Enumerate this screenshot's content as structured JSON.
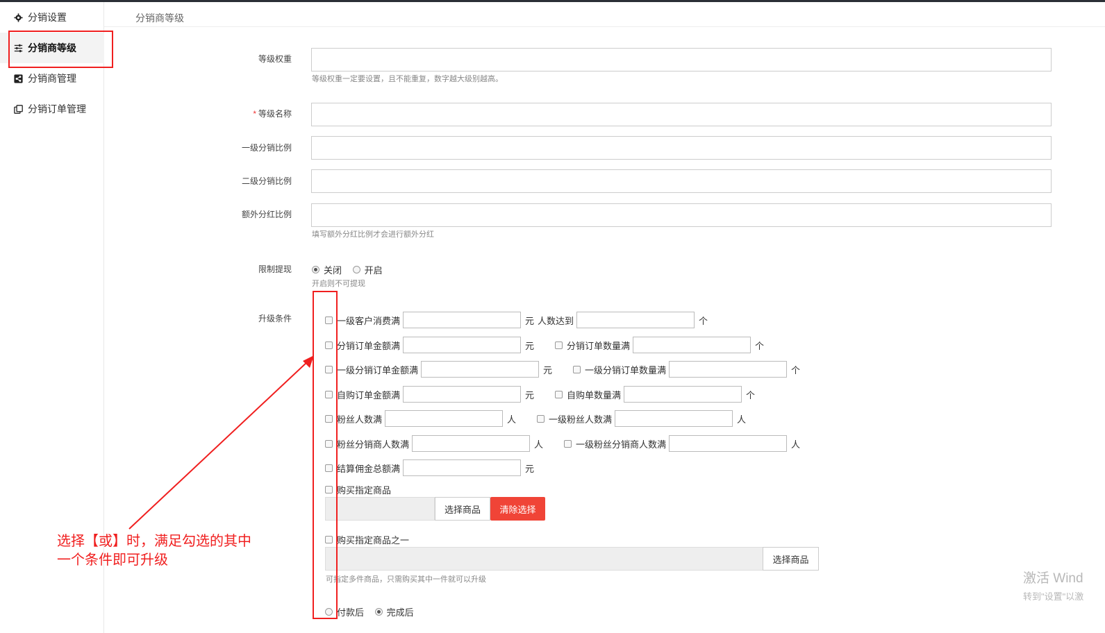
{
  "colors": {
    "accent_red": "#f04437",
    "annotation_red": "#f01f1f"
  },
  "sidebar": {
    "items": [
      {
        "label": "分销设置",
        "icon": "gear-icon"
      },
      {
        "label": "分销商等级",
        "icon": "sliders-icon",
        "active": true
      },
      {
        "label": "分销商管理",
        "icon": "share-icon"
      },
      {
        "label": "分销订单管理",
        "icon": "copy-icon"
      }
    ]
  },
  "header": {
    "breadcrumb": "分销商等级"
  },
  "form": {
    "weight_label": "等级权重",
    "weight_hint": "等级权重一定要设置，且不能重复，数字越大级别越高。",
    "required_mark": "*",
    "name_label": "等级名称",
    "level1_label": "一级分销比例",
    "level2_label": "二级分销比例",
    "bonus_label": "额外分红比例",
    "bonus_hint": "填写额外分红比例才会进行额外分红",
    "withdraw_label": "限制提现",
    "withdraw_options": [
      "关闭",
      "开启"
    ],
    "withdraw_selected": "关闭",
    "withdraw_hint": "开启则不可提现",
    "upgrade_label": "升级条件",
    "conditions": {
      "c1_a": "一级客户消费满",
      "c1_unit": "元",
      "c1_b": "人数达到",
      "c1_b_unit": "个",
      "c2_a": "分销订单金额满",
      "c2_unit": "元",
      "c2_b": "分销订单数量满",
      "c2_b_unit": "个",
      "c3_a": "一级分销订单金额满",
      "c3_unit": "元",
      "c3_b": "一级分销订单数量满",
      "c3_b_unit": "个",
      "c4_a": "自购订单金额满",
      "c4_unit": "元",
      "c4_b": "自购单数量满",
      "c4_b_unit": "个",
      "c5_a": "粉丝人数满",
      "c5_unit": "人",
      "c5_b": "一级粉丝人数满",
      "c5_b_unit": "人",
      "c6_a": "粉丝分销商人数满",
      "c6_unit": "人",
      "c6_b": "一级粉丝分销商人数满",
      "c6_b_unit": "人",
      "c7_a": "结算佣金总额满",
      "c7_unit": "元"
    },
    "buy_goods_label": "购买指定商品",
    "select_goods_btn": "选择商品",
    "clear_btn": "清除选择",
    "buy_one_label": "购买指定商品之一",
    "buy_one_hint": "可指定多件商品，只需购买其中一件就可以升级",
    "timing_options": [
      "付款后",
      "完成后"
    ],
    "timing_selected": "完成后"
  },
  "annotation": {
    "line1": "选择【或】时，满足勾选的其中",
    "line2": "一个条件即可升级"
  },
  "watermark": {
    "line1": "激活 Wind",
    "line2": "转到\"设置\"以激"
  }
}
